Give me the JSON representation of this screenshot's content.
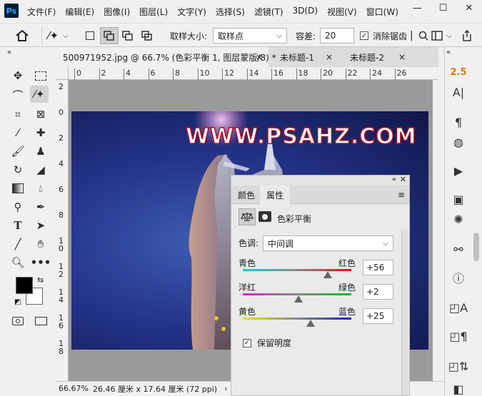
{
  "app": {
    "logo": "Ps"
  },
  "menu": [
    "文件(F)",
    "编辑(E)",
    "图像(I)",
    "图层(L)",
    "文字(Y)",
    "选择(S)",
    "滤镜(T)",
    "3D(D)",
    "视图(V)",
    "窗口(W)",
    "帮助("
  ],
  "window_controls": {
    "minimize": "—",
    "maximize": "☐",
    "close": "✕"
  },
  "options": {
    "sample_size_label": "取样大小:",
    "sample_size_value": "取样点",
    "tolerance_label": "容差:",
    "tolerance_value": "20",
    "antialias_label": "消除锯齿"
  },
  "tabs": [
    {
      "label": "500971952.jpg @ 66.7% (色彩平衡 1, 图层蒙版/8) *",
      "close": "×"
    },
    {
      "label": "未标题-1",
      "close": "×"
    },
    {
      "label": "未标题-2",
      "close": "×"
    }
  ],
  "ruler_h": [
    "0",
    "2",
    "4",
    "6",
    "8",
    "10",
    "12",
    "14",
    "16",
    "18",
    "20",
    "22",
    "24",
    "26"
  ],
  "ruler_v": [
    "2",
    "0",
    "2",
    "4",
    "6",
    "8",
    "1\n0",
    "1\n2",
    "1\n4",
    "1\n6",
    "1\n8"
  ],
  "image": {
    "watermark": "WWW.PSAHZ.COM"
  },
  "status": {
    "zoom": "66.67%",
    "doc_info": "26.46 厘米 x 17.64 厘米 (72 ppi)",
    "arrow": "›"
  },
  "right_dock": {
    "top_label": "2.5"
  },
  "properties": {
    "tab_color": "颜色",
    "tab_properties": "属性",
    "adjustment_name": "色彩平衡",
    "tone_label": "色调:",
    "tone_value": "中间调",
    "sliders": [
      {
        "left": "青色",
        "right": "红色",
        "value": "+56",
        "norm": 0.78,
        "colors": [
          "#00d8d8",
          "#e81010"
        ]
      },
      {
        "left": "洋红",
        "right": "绿色",
        "value": "+2",
        "norm": 0.51,
        "colors": [
          "#e020e0",
          "#10c010"
        ]
      },
      {
        "left": "黄色",
        "right": "蓝色",
        "value": "+25",
        "norm": 0.625,
        "colors": [
          "#e8e800",
          "#1020d0"
        ]
      }
    ],
    "preserve_label": "保留明度"
  },
  "colors": {
    "foreground": "#000000",
    "background": "#ffffff"
  }
}
